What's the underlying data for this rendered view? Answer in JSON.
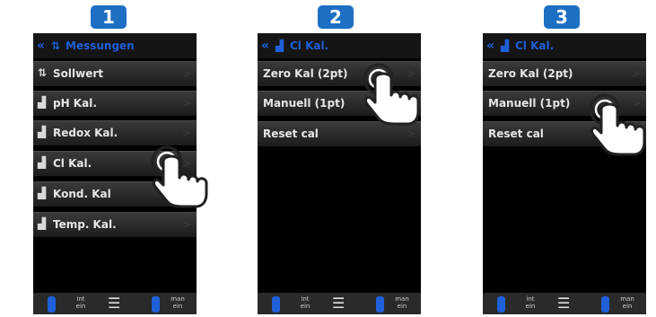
{
  "steps": [
    "1",
    "2",
    "3"
  ],
  "screen1": {
    "header": {
      "back_icon": "double-chevron-left",
      "icon": "arrows-icon",
      "title": "Messungen"
    },
    "rows": [
      {
        "icon": "arrows",
        "label": "Sollwert"
      },
      {
        "icon": "calibrate",
        "label": "pH Kal."
      },
      {
        "icon": "calibrate",
        "label": "Redox Kal."
      },
      {
        "icon": "calibrate",
        "label": "Cl Kal."
      },
      {
        "icon": "calibrate",
        "label": "Kond. Kal"
      },
      {
        "icon": "calibrate",
        "label": "Temp. Kal."
      }
    ]
  },
  "screen2": {
    "header": {
      "back_icon": "double-chevron-left",
      "icon": "calibrate-icon",
      "title": "Cl Kal."
    },
    "rows": [
      {
        "label": "Zero Kal (2pt)"
      },
      {
        "label": "Manuell (1pt)"
      },
      {
        "label": "Reset cal"
      }
    ]
  },
  "screen3": {
    "header": {
      "back_icon": "double-chevron-left",
      "icon": "calibrate-icon",
      "title": "Cl Kal."
    },
    "rows": [
      {
        "label": "Zero Kal (2pt)"
      },
      {
        "label": "Manuell (1pt)"
      },
      {
        "label": "Reset cal"
      }
    ]
  },
  "footer": {
    "left_label_line1": "int",
    "left_label_line2": "ein",
    "right_label_line1": "man",
    "right_label_line2": "ein"
  },
  "colors": {
    "badge": "#1d6fc3",
    "accent": "#1f5fd8",
    "screen_bg": "#000000"
  }
}
